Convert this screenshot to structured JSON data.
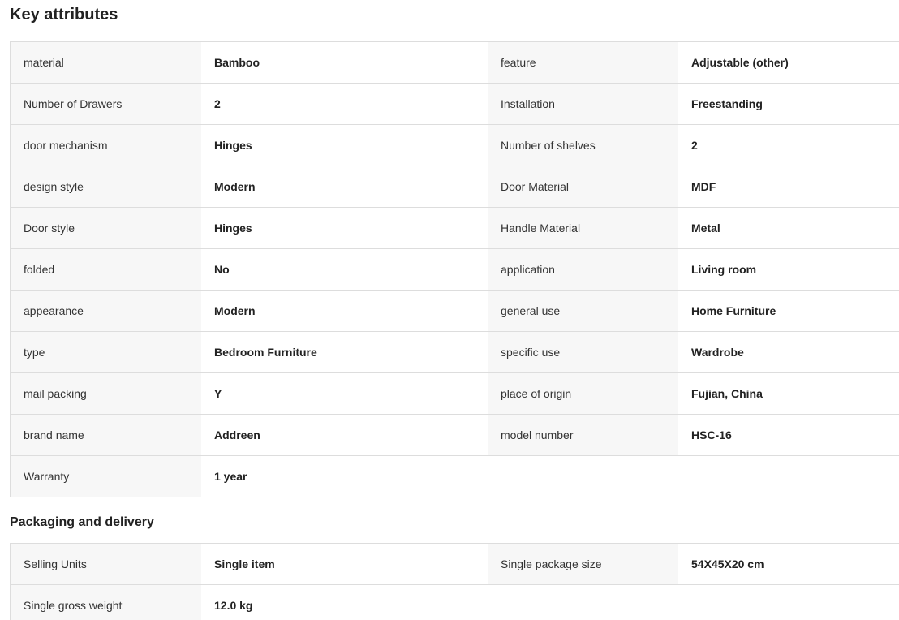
{
  "key_attributes": {
    "title": "Key attributes",
    "rows": [
      [
        {
          "label": "material",
          "value": "Bamboo"
        },
        {
          "label": "feature",
          "value": "Adjustable (other)"
        }
      ],
      [
        {
          "label": "Number of Drawers",
          "value": "2"
        },
        {
          "label": "Installation",
          "value": "Freestanding"
        }
      ],
      [
        {
          "label": "door mechanism",
          "value": "Hinges"
        },
        {
          "label": "Number of shelves",
          "value": "2"
        }
      ],
      [
        {
          "label": "design style",
          "value": "Modern"
        },
        {
          "label": "Door Material",
          "value": "MDF"
        }
      ],
      [
        {
          "label": "Door style",
          "value": "Hinges"
        },
        {
          "label": "Handle Material",
          "value": "Metal"
        }
      ],
      [
        {
          "label": "folded",
          "value": "No"
        },
        {
          "label": "application",
          "value": "Living room"
        }
      ],
      [
        {
          "label": "appearance",
          "value": "Modern"
        },
        {
          "label": "general use",
          "value": "Home Furniture"
        }
      ],
      [
        {
          "label": "type",
          "value": "Bedroom Furniture"
        },
        {
          "label": "specific use",
          "value": "Wardrobe"
        }
      ],
      [
        {
          "label": "mail packing",
          "value": "Y"
        },
        {
          "label": "place of origin",
          "value": "Fujian, China"
        }
      ],
      [
        {
          "label": "brand name",
          "value": "Addreen"
        },
        {
          "label": "model number",
          "value": "HSC-16"
        }
      ],
      [
        {
          "label": "Warranty",
          "value": "1 year"
        }
      ]
    ]
  },
  "packaging": {
    "title": "Packaging and delivery",
    "rows": [
      [
        {
          "label": "Selling Units",
          "value": "Single item"
        },
        {
          "label": "Single package size",
          "value": "54X45X20 cm"
        }
      ],
      [
        {
          "label": "Single gross weight",
          "value": "12.0 kg"
        }
      ]
    ]
  }
}
